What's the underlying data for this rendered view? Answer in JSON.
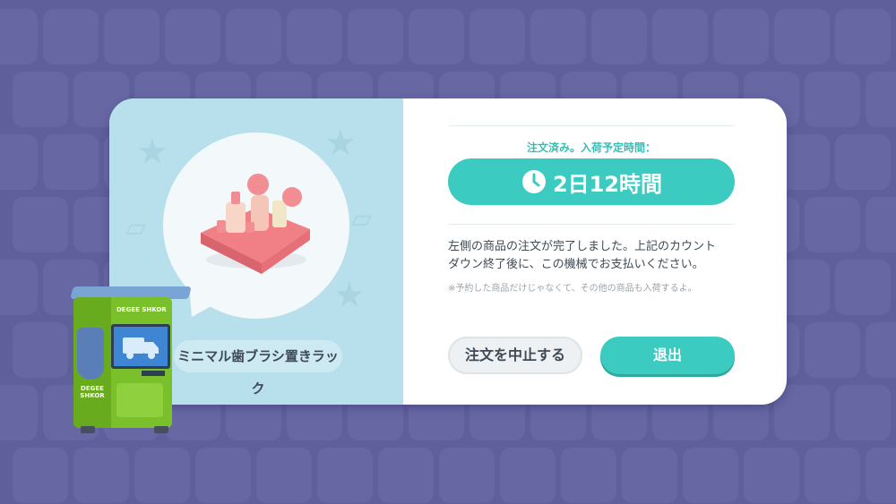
{
  "item": {
    "name": "ミニマル歯ブラシ置きラック"
  },
  "order": {
    "status_label": "注文済み。入荷予定時間：",
    "remaining_time": "2日12時間",
    "message_line1": "左側の商品の注文が完了しました。上記のカウント",
    "message_line2": "ダウン終了後に、この機械でお支払いください。",
    "note": "※予約した商品だけじゃなくて、その他の商品も入荷するよ。"
  },
  "buttons": {
    "cancel_label": "注文を中止する",
    "exit_label": "退出"
  },
  "kiosk": {
    "logo_text": "DEGEE SHKOR",
    "side_label": "DEGEE SHKOR"
  },
  "colors": {
    "background": "#5f5f9c",
    "accent": "#3ccbc0",
    "left_panel": "#b8e0ec",
    "kiosk_green": "#7ac02b"
  },
  "icons": {
    "time": "clock-icon",
    "item": "toothbrush-holder-icon",
    "kiosk_screen": "delivery-truck-icon"
  }
}
